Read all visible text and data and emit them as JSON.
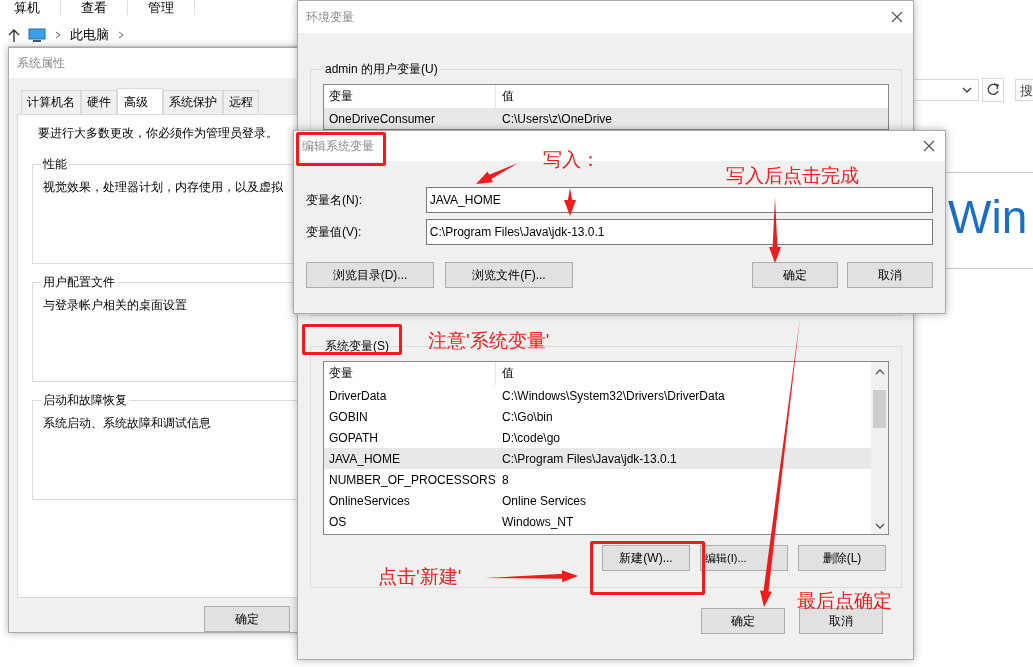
{
  "explorer": {
    "ribbon_tabs": [
      "算机",
      "查看",
      "管理"
    ],
    "breadcrumb": "此电脑",
    "search_placeholder": "搜",
    "banner": "Win"
  },
  "system_properties": {
    "title": "系统属性",
    "tabs": [
      {
        "label": "计算机名",
        "selected": false
      },
      {
        "label": "硬件",
        "selected": false
      },
      {
        "label": "高级",
        "selected": true
      },
      {
        "label": "系统保护",
        "selected": false
      },
      {
        "label": "远程",
        "selected": false
      }
    ],
    "notice": "要进行大多数更改，你必须作为管理员登录。",
    "groups": [
      {
        "title": "性能",
        "description": "视觉效果，处理器计划，内存使用，以及虚拟"
      },
      {
        "title": "用户配置文件",
        "description": "与登录帐户相关的桌面设置"
      },
      {
        "title": "启动和故障恢复",
        "description": "系统启动、系统故障和调试信息"
      }
    ],
    "ok_button": "确定"
  },
  "environment_variables": {
    "title": "环境变量",
    "user_variables": {
      "title": "admin 的用户变量(U)",
      "columns": [
        "变量",
        "值"
      ],
      "rows": [
        {
          "name": "OneDriveConsumer",
          "value": "C:\\Users\\z\\OneDrive",
          "selected": true
        }
      ]
    },
    "system_variables": {
      "title": "系统变量(S)",
      "columns": [
        "变量",
        "值"
      ],
      "rows": [
        {
          "name": "DriverData",
          "value": "C:\\Windows\\System32\\Drivers\\DriverData",
          "selected": false
        },
        {
          "name": "GOBIN",
          "value": "C:\\Go\\bin",
          "selected": false
        },
        {
          "name": "GOPATH",
          "value": "D:\\code\\go",
          "selected": false
        },
        {
          "name": "JAVA_HOME",
          "value": "C:\\Program Files\\Java\\jdk-13.0.1",
          "selected": true
        },
        {
          "name": "NUMBER_OF_PROCESSORS",
          "value": "8",
          "selected": false
        },
        {
          "name": "OnlineServices",
          "value": "Online Services",
          "selected": false
        },
        {
          "name": "OS",
          "value": "Windows_NT",
          "selected": false
        }
      ]
    },
    "table_buttons": [
      "新建(W)...",
      "编辑(I)...",
      "删除(L)"
    ],
    "dialog_buttons": [
      "确定",
      "取消"
    ]
  },
  "edit_dialog": {
    "title": "编辑系统变量",
    "fields": [
      {
        "label": "变量名(N):",
        "value": "JAVA_HOME"
      },
      {
        "label": "变量值(V):",
        "value": "C:\\Program Files\\Java\\jdk-13.0.1"
      }
    ],
    "browse_buttons": [
      "浏览目录(D)...",
      "浏览文件(F)..."
    ],
    "buttons": [
      "确定",
      "取消"
    ]
  },
  "annotations": [
    {
      "text": "写入："
    },
    {
      "text": "写入后点击完成"
    },
    {
      "text": "注意'系统变量'"
    },
    {
      "text": "点击'新建'"
    },
    {
      "text": "最后点确定"
    }
  ]
}
